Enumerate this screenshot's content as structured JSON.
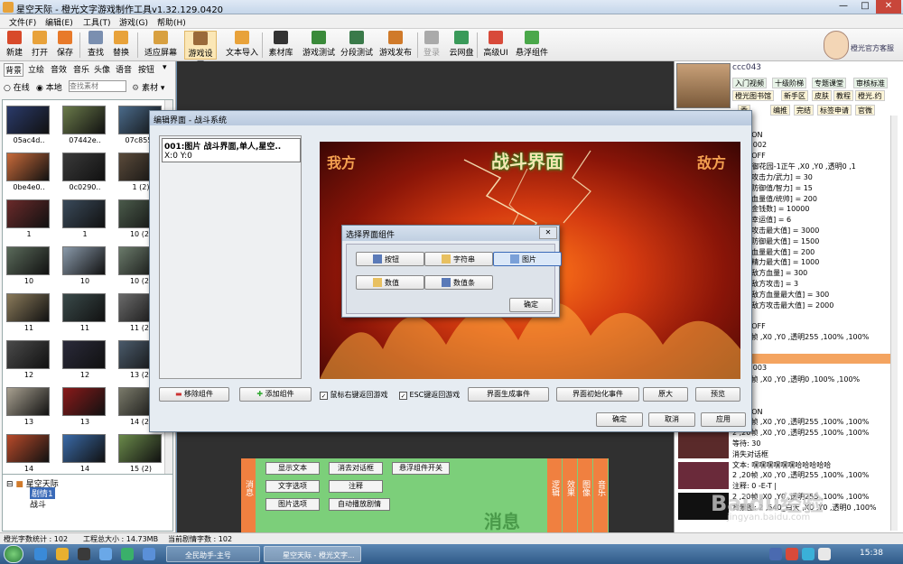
{
  "window": {
    "title": "星空天际 - 橙光文字游戏制作工具v1.32.129.0420",
    "min": "—",
    "max": "□",
    "close": "✕"
  },
  "menu": [
    "文件(F)",
    "编辑(E)",
    "工具(T)",
    "游戏(G)",
    "帮助(H)"
  ],
  "toolbar": [
    {
      "label": "新建",
      "icon": "new-icon",
      "color": "#d84a2a"
    },
    {
      "label": "打开",
      "icon": "open-folder-icon",
      "color": "#e8a23a"
    },
    {
      "label": "保存",
      "icon": "save-icon",
      "color": "#e87a2a"
    },
    {
      "label": "查找",
      "icon": "find-icon",
      "color": "#7a8fb0"
    },
    {
      "label": "替换",
      "icon": "replace-icon",
      "color": "#e8a23a"
    },
    {
      "label": "适应屏幕",
      "icon": "fit-screen-icon",
      "color": "#d8a040"
    },
    {
      "label": "游戏设置",
      "icon": "gear-icon",
      "color": "#9a6a3a"
    },
    {
      "label": "文本导入",
      "icon": "import-box-icon",
      "color": "#e8a23a"
    },
    {
      "label": "素材库",
      "icon": "clapper-icon",
      "color": "#333333"
    },
    {
      "label": "游戏测试",
      "icon": "play-test-icon",
      "color": "#3a8a3a"
    },
    {
      "label": "分段测试",
      "icon": "segment-test-icon",
      "color": "#3a7a4a"
    },
    {
      "label": "游戏发布",
      "icon": "publish-icon",
      "color": "#d07a2a"
    },
    {
      "label": "登录",
      "icon": "login-icon",
      "color": "#aaaaaa"
    },
    {
      "label": "云网盘",
      "icon": "cloud-drive-icon",
      "color": "#3a9a5a"
    },
    {
      "label": "高级UI",
      "icon": "advanced-ui-icon",
      "color": "#d84a3a"
    },
    {
      "label": "悬浮组件",
      "icon": "float-widget-icon",
      "color": "#4aa84a"
    }
  ],
  "support_label": "橙光官方客服",
  "left": {
    "tabs": [
      "背景",
      "立绘",
      "音效",
      "音乐",
      "头像",
      "语音",
      "按钮"
    ],
    "source_online": "在线",
    "source_local": "本地",
    "search_placeholder": "查找素材",
    "material_label": "素材",
    "thumbs": [
      {
        "cap": "05ac4d..",
        "color": "#2a3a6a"
      },
      {
        "cap": "07442e..",
        "color": "#6a7a4a"
      },
      {
        "cap": "07c855..",
        "color": "#4a6a8a"
      },
      {
        "cap": "0be4e0..",
        "color": "#c86a3a"
      },
      {
        "cap": "0c0290..",
        "color": "#3a3a3a"
      },
      {
        "cap": "1 (2)",
        "color": "#5a4a3a"
      },
      {
        "cap": "1",
        "color": "#6a2a2a"
      },
      {
        "cap": "1",
        "color": "#3a4a5a"
      },
      {
        "cap": "10 (2)",
        "color": "#4a5a4a"
      },
      {
        "cap": "10",
        "color": "#5a6a5a"
      },
      {
        "cap": "10",
        "color": "#8a9aaa"
      },
      {
        "cap": "10 (2)",
        "color": "#6a7a6a"
      },
      {
        "cap": "11",
        "color": "#8a7a5a"
      },
      {
        "cap": "11",
        "color": "#3a4a4a"
      },
      {
        "cap": "11 (2)",
        "color": "#6a6a6a"
      },
      {
        "cap": "12",
        "color": "#4a4a4a"
      },
      {
        "cap": "12",
        "color": "#2a2a3a"
      },
      {
        "cap": "13 (2)",
        "color": "#4a5a6a"
      },
      {
        "cap": "13",
        "color": "#a8a090"
      },
      {
        "cap": "13",
        "color": "#8a1a1a"
      },
      {
        "cap": "14 (2)",
        "color": "#7a7a6a"
      },
      {
        "cap": "14",
        "color": "#b84a2a"
      },
      {
        "cap": "14",
        "color": "#3a6aa8"
      },
      {
        "cap": "15 (2)",
        "color": "#6a8a4a"
      }
    ],
    "tree_root": "星空天际",
    "tree_children": [
      "剧情1",
      "战斗"
    ]
  },
  "dialog": {
    "title": "编辑界面 - 战斗系统",
    "component_line1": "001:图片 战斗界面,单人,星空..",
    "component_line2": "X:0  Y:0",
    "preview_title": "战斗界面",
    "preview_left": "我方",
    "preview_right": "敌方",
    "remove_label": "移除组件",
    "add_label": "添加组件",
    "chk_right_click": "鼠标右键返回游戏",
    "chk_esc": "ESC键返回游戏",
    "btn_gen_event": "界面生成事件",
    "btn_init_event": "界面初始化事件",
    "btn_original": "原大",
    "btn_preview": "预览",
    "btn_ok": "确定",
    "btn_cancel": "取消",
    "btn_apply": "应用"
  },
  "subdialog": {
    "title": "选择界面组件",
    "close": "✕",
    "items": [
      "按钮",
      "字符串",
      "图片",
      "数值",
      "数值条"
    ],
    "ok": "确定"
  },
  "bottom": {
    "left_tab": "消息",
    "green_buttons": [
      "显示文本",
      "消去对话框",
      "悬浮组件开关",
      "文字选项",
      "注释",
      "图片选项",
      "自动播放剧情"
    ],
    "watermark": "消息",
    "right_tabs": [
      "逻辑",
      "效果",
      "图像",
      "音乐"
    ]
  },
  "right": {
    "user": "ccc043",
    "links_row1": [
      "入门视频",
      "十级阶梯",
      "专题课堂",
      "审核标准"
    ],
    "links_row2": [
      "橙光图书馆",
      "新手区",
      "皮肤",
      "教程",
      "橙光.约"
    ],
    "links_row3": [
      "季",
      "编推",
      "完结",
      "标签申请",
      "官微"
    ],
    "code": [
      "-N-T |",
      "开关: ON",
      "-E-T | 002",
      "开关: OFF",
      ",540_御花园-1正午 ,X0 ,Y0 ,透明0 ,1",
      "[009:攻击力/武力] = 30",
      "[010:防御值/智力] = 15",
      "[011:血量值/统帅] = 200",
      "[012:金钱数] = 10000",
      "[014:幸运值] = 6",
      "[015:攻击最大值] = 3000",
      "[016:防御最大值] = 1500",
      "[017:血量最大值] = 200",
      "[018:精力最大值] = 1000",
      "[019:敌方血量] = 300",
      "[020:敌方攻击] = 3",
      "[021:敌方血量最大值] = 300",
      "[022:敌方攻击最大值] = 2000",
      "上",
      "开关: OFF",
      "2 ,20帧 ,X0 ,Y0 ,透明255 ,100% ,100%",
      "",
      "剧情",
      "-E-T | 003",
      "2 ,20帧 ,X0 ,Y0 ,透明0 ,100% ,100%",
      "",
      "-N-T |",
      "开关: ON",
      "2 ,20帧 ,X0 ,Y0 ,透明255 ,100% ,100%",
      "2 ,20帧 ,X0 ,Y0 ,透明255 ,100% ,100%",
      "等待: 30",
      "消失对话框",
      "文本: 嘿嘿嘿嘿嘿嘿哈哈哈哈哈",
      "2 ,20帧 ,X0 ,Y0 ,透明255 ,100% ,100%",
      "注释: 0 -E-T |",
      "2 ,20帧 ,X0 ,Y0 ,透明255 ,100% ,100%",
      "背景图: 2 ,540_白天 ,X0 ,Y0 ,透明0 ,100%"
    ],
    "watermark": "Baidu经验",
    "watermark_url": "jingyan.baidu.com"
  },
  "status": {
    "chars": "橙光字数统计 : 102",
    "size": "工程总大小 : 14.73MB",
    "current": "当前剧情字数 : 102"
  },
  "taskbar": {
    "task1": "全民助手-主号",
    "task2": "星空天际 - 橙光文字...",
    "time": "15:38"
  },
  "colors": {
    "accent_orange": "#f08040",
    "green_panel": "#7ccf7a",
    "highlight": "#f4a460",
    "link_bg": "#fdf5d8"
  }
}
